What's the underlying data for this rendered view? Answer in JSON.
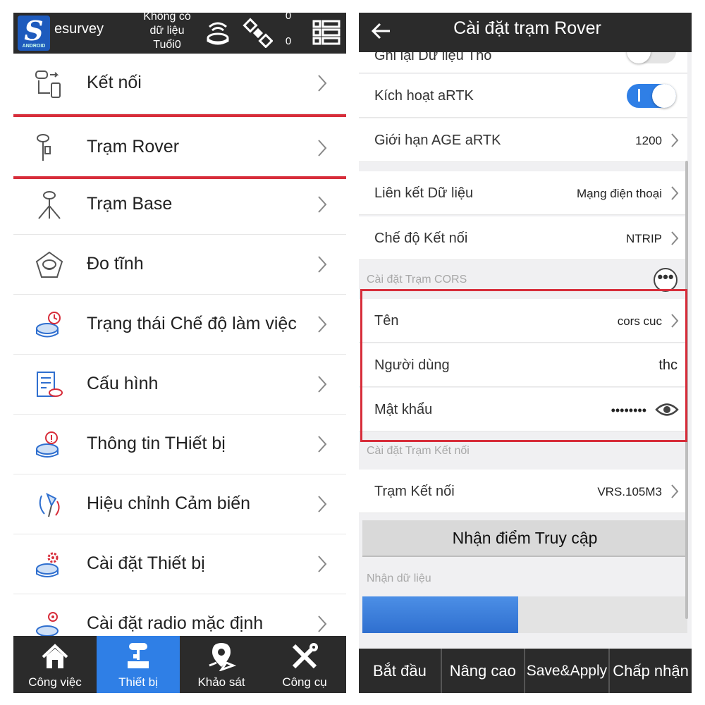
{
  "left": {
    "brand": "esurvey",
    "logo_letter": "S",
    "logo_sub": "ANDROID",
    "status_line1": "Không có",
    "status_line2": "dữ liệu",
    "status_line3": "Tuổi0",
    "count_top": "0",
    "count_bottom": "0",
    "menu": [
      {
        "label": "Kết nối",
        "icon": "connection-icon"
      },
      {
        "label": "Trạm Rover",
        "icon": "rover-icon",
        "highlighted": true
      },
      {
        "label": "Trạm Base",
        "icon": "base-tripod-icon"
      },
      {
        "label": "Đo tĩnh",
        "icon": "static-survey-icon"
      },
      {
        "label": "Trạng thái Chế độ làm việc",
        "icon": "work-mode-icon"
      },
      {
        "label": "Cấu hình",
        "icon": "configuration-icon"
      },
      {
        "label": "Thông tin THiết bị",
        "icon": "device-info-icon"
      },
      {
        "label": "Hiệu chỉnh Cảm biến",
        "icon": "sensor-calibration-icon"
      },
      {
        "label": "Cài đặt Thiết bị",
        "icon": "device-settings-icon"
      },
      {
        "label": "Cài đặt radio mặc định",
        "icon": "radio-settings-icon"
      }
    ],
    "nav": [
      {
        "label": "Công việc",
        "icon": "home-icon"
      },
      {
        "label": "Thiết bị",
        "icon": "device-icon",
        "active": true
      },
      {
        "label": "Khảo sát",
        "icon": "map-pin-icon"
      },
      {
        "label": "Công cụ",
        "icon": "tools-icon"
      }
    ]
  },
  "right": {
    "title": "Cài đặt trạm Rover",
    "rows": {
      "raw_data": {
        "label": "Ghi lại Dữ liệu Thô"
      },
      "artk": {
        "label": "Kích hoạt aRTK"
      },
      "age_limit": {
        "label": "Giới hạn AGE aRTK",
        "value": "1200"
      },
      "data_link": {
        "label": "Liên kết Dữ liệu",
        "value": "Mạng điện thoại"
      },
      "conn_mode": {
        "label": "Chế độ Kết nối",
        "value": "NTRIP"
      },
      "name": {
        "label": "Tên",
        "value": "cors cuc"
      },
      "user": {
        "label": "Người dùng",
        "value": "thc"
      },
      "password": {
        "label": "Mật khẩu",
        "value": "••••••••"
      },
      "mountpoint": {
        "label": "Trạm Kết nối",
        "value": "VRS.105M3"
      }
    },
    "cors_section": "Cài đặt Trạm CORS",
    "conn_section": "Cài đặt Trạm Kết nối",
    "access_button": "Nhận điểm Truy cập",
    "receive_section": "Nhận dữ liệu",
    "more_label": "•••",
    "progress": 0.48,
    "buttons": [
      "Bắt đầu",
      "Nâng cao",
      "Save&Apply",
      "Chấp nhận"
    ],
    "colors": {
      "accent": "#2f7fe6",
      "highlight": "#d72d3a",
      "bar": "#2b2b2b"
    }
  }
}
